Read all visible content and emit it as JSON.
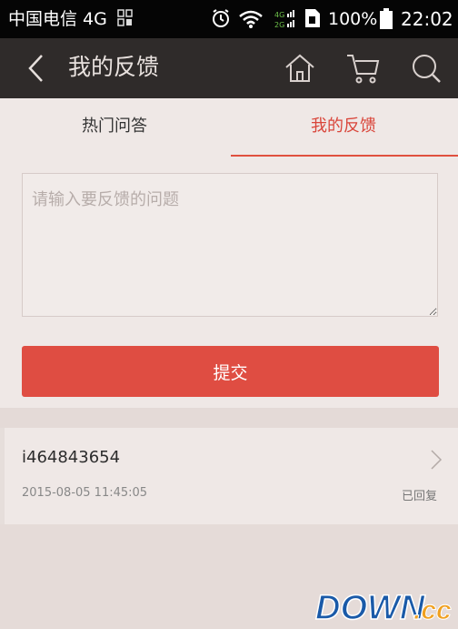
{
  "status_bar": {
    "carrier": "中国电信 4G",
    "battery": "100%",
    "time": "22:02",
    "icons": [
      "signal-icon",
      "alarm-icon",
      "wifi-icon",
      "network-4g-2g-icon",
      "sim-icon",
      "battery-icon"
    ]
  },
  "header": {
    "title": "我的反馈",
    "icons": [
      "back-arrow-icon",
      "home-icon",
      "cart-icon",
      "search-icon"
    ]
  },
  "tabs": [
    {
      "label": "热门问答",
      "active": false
    },
    {
      "label": "我的反馈",
      "active": true
    }
  ],
  "form": {
    "placeholder": "请输入要反馈的问题",
    "value": "",
    "submit_label": "提交"
  },
  "feedback_list": [
    {
      "user": "i464843654",
      "date": "2015-08-05 11:45:05",
      "status": "已回复"
    }
  ],
  "watermark": {
    "text": "DOWN.cc"
  },
  "colors": {
    "accent": "#df4d42",
    "header_bg": "#2f2b2a",
    "page_bg": "#efe8e6",
    "status_bg": "#050505"
  }
}
